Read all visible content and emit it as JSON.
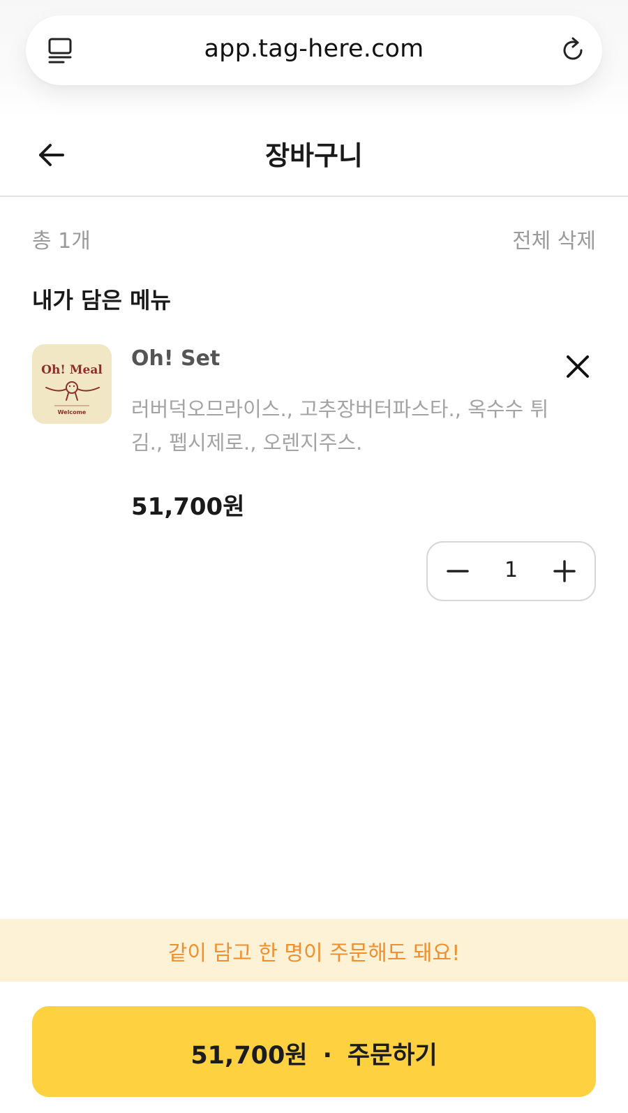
{
  "browser": {
    "url": "app.tag-here.com",
    "icons": {
      "left": "reader-mode-icon",
      "right": "reload-icon"
    }
  },
  "header": {
    "title": "장바구니",
    "back_icon": "arrow-left-icon"
  },
  "summary": {
    "total_count": "총 1개",
    "delete_all": "전체 삭제"
  },
  "section": {
    "title": "내가 담은 메뉴"
  },
  "cart": {
    "items": [
      {
        "name": "Oh! Set",
        "thumbnail": {
          "logo_text": "Oh! Meal",
          "tagline": "Welcome"
        },
        "options": "러버덕오므라이스., 고추장버터파스타., 옥수수 튀김., 펩시제로., 오렌지주스.",
        "price": "51,700원",
        "quantity": "1",
        "remove_icon": "close-icon"
      }
    ]
  },
  "banner": {
    "text": "같이 담고 한 명이 주문해도 돼요!"
  },
  "order": {
    "price": "51,700원",
    "separator": "·",
    "label": "주문하기"
  },
  "colors": {
    "accent": "#fdd13f",
    "banner_bg": "#fdf1d6",
    "banner_text": "#ef8f2f",
    "muted_text": "#9a9a9a"
  }
}
